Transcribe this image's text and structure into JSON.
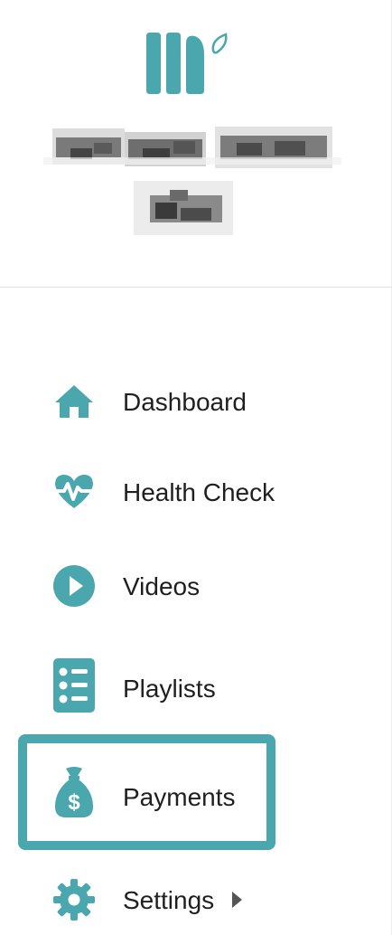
{
  "colors": {
    "accent": "#4aa7ad",
    "highlight": "#4aa7ad",
    "text": "#1f1f1f"
  },
  "header": {
    "logo": "brand-logo",
    "user_name": ""
  },
  "nav": {
    "items": [
      {
        "label": "Dashboard",
        "icon": "home-icon"
      },
      {
        "label": "Health Check",
        "icon": "heartbeat-icon"
      },
      {
        "label": "Videos",
        "icon": "play-circle-icon"
      },
      {
        "label": "Playlists",
        "icon": "list-icon"
      },
      {
        "label": "Payments",
        "icon": "money-bag-icon",
        "highlighted": true
      },
      {
        "label": "Settings",
        "icon": "gear-icon",
        "has_submenu": true
      }
    ]
  }
}
